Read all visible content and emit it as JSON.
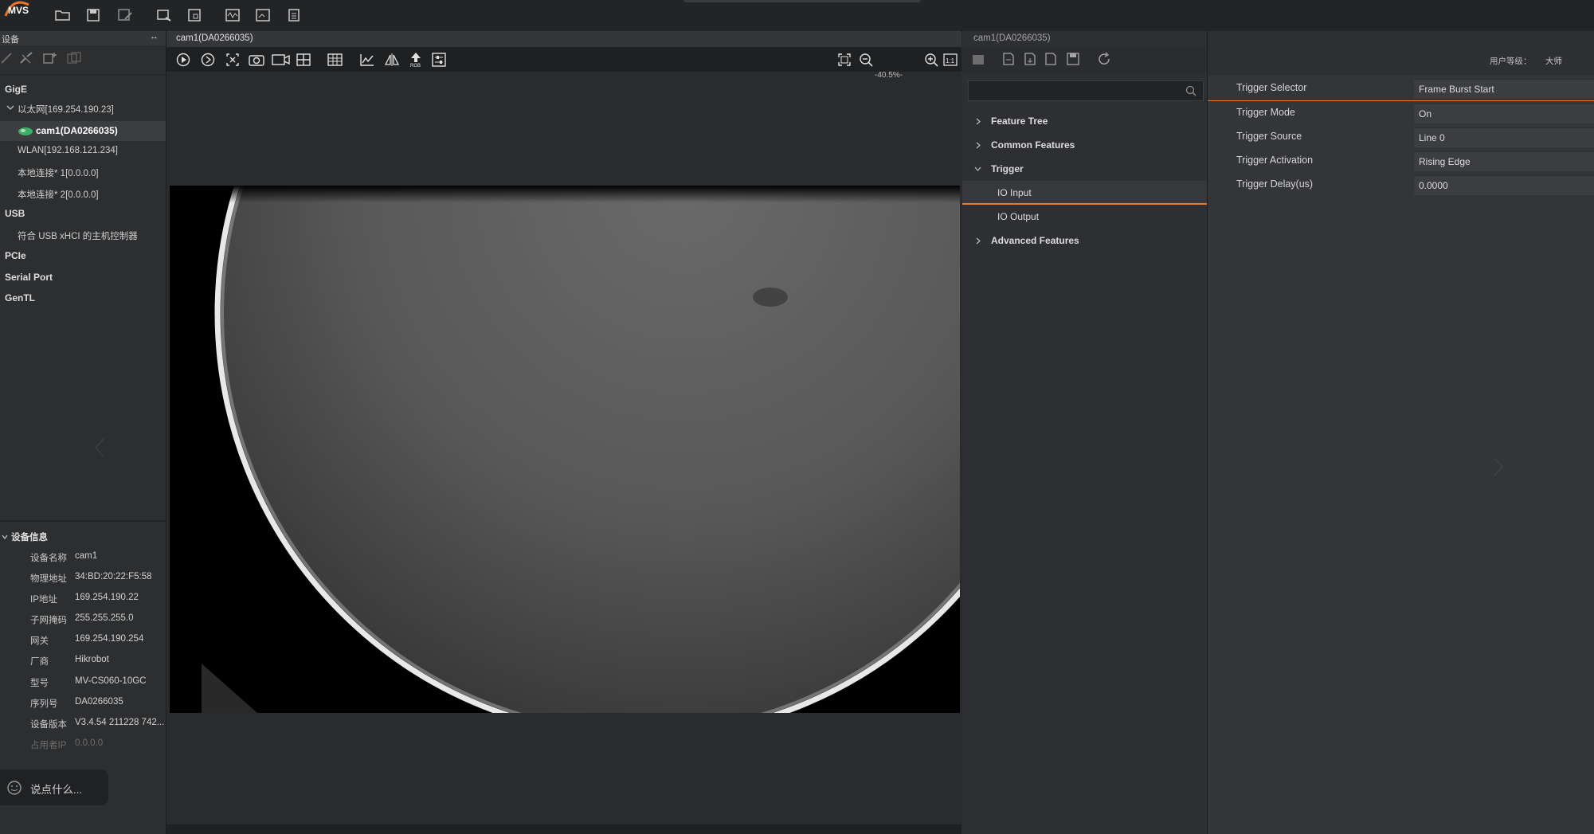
{
  "app": {
    "logo_text": "MVS",
    "colors": {
      "accent": "#e27c2e",
      "selected_cam_icon": "#3fae6a"
    }
  },
  "toolbar": {
    "icons": [
      "folder-open-icon",
      "save-icon",
      "save-as-icon",
      "device-list-icon",
      "window-icon",
      "waveform-icon",
      "image-compare-icon",
      "clipboard-icon"
    ]
  },
  "left_panel": {
    "header": "设备",
    "pin_symbol": "↔",
    "tree": {
      "gige": "GigE",
      "ethernet": "以太网[169.254.190.23]",
      "camera": "cam1(DA0266035)",
      "wlan": "WLAN[192.168.121.234]",
      "local1": "本地连接* 1[0.0.0.0]",
      "local2": "本地连接* 2[0.0.0.0]",
      "usb": "USB",
      "usb_host": "符合 USB xHCI 的主机控制器",
      "pcie": "PCIe",
      "serial": "Serial Port",
      "gentl": "GenTL"
    },
    "device_info": {
      "title": "设备信息",
      "rows": [
        {
          "label": "设备名称",
          "value": "cam1"
        },
        {
          "label": "物理地址",
          "value": "34:BD:20:22:F5:58"
        },
        {
          "label": "IP地址",
          "value": "169.254.190.22"
        },
        {
          "label": "子网掩码",
          "value": "255.255.255.0"
        },
        {
          "label": "网关",
          "value": "169.254.190.254"
        },
        {
          "label": "厂商",
          "value": "Hikrobot"
        },
        {
          "label": "型号",
          "value": "MV-CS060-10GC"
        },
        {
          "label": "序列号",
          "value": "DA0266035"
        },
        {
          "label": "设备版本",
          "value": "V3.4.54 211228 742..."
        },
        {
          "label": "占用者IP",
          "value": "0.0.0.0"
        }
      ]
    },
    "chat_placeholder": "说点什么..."
  },
  "viewer": {
    "tab": "cam1(DA0266035)",
    "zoom": "-40.5%-"
  },
  "property_tree": {
    "tab": "cam1(DA0266035)",
    "search_placeholder": "",
    "items": [
      {
        "label": "Feature Tree",
        "expanded": false
      },
      {
        "label": "Common Features",
        "expanded": false
      },
      {
        "label": "Trigger",
        "expanded": true
      },
      {
        "label": "IO Input",
        "selected": true
      },
      {
        "label": "IO Output"
      },
      {
        "label": "Advanced Features",
        "expanded": false
      }
    ]
  },
  "property_grid": {
    "user_level_label": "用户等级：",
    "user_level_value": "大师",
    "rows": [
      {
        "label": "Trigger Selector",
        "value": "Frame Burst Start"
      },
      {
        "label": "Trigger Mode",
        "value": "On"
      },
      {
        "label": "Trigger Source",
        "value": "Line 0"
      },
      {
        "label": "Trigger Activation",
        "value": "Rising Edge"
      },
      {
        "label": "Trigger Delay(us)",
        "value": "0.0000"
      }
    ]
  }
}
